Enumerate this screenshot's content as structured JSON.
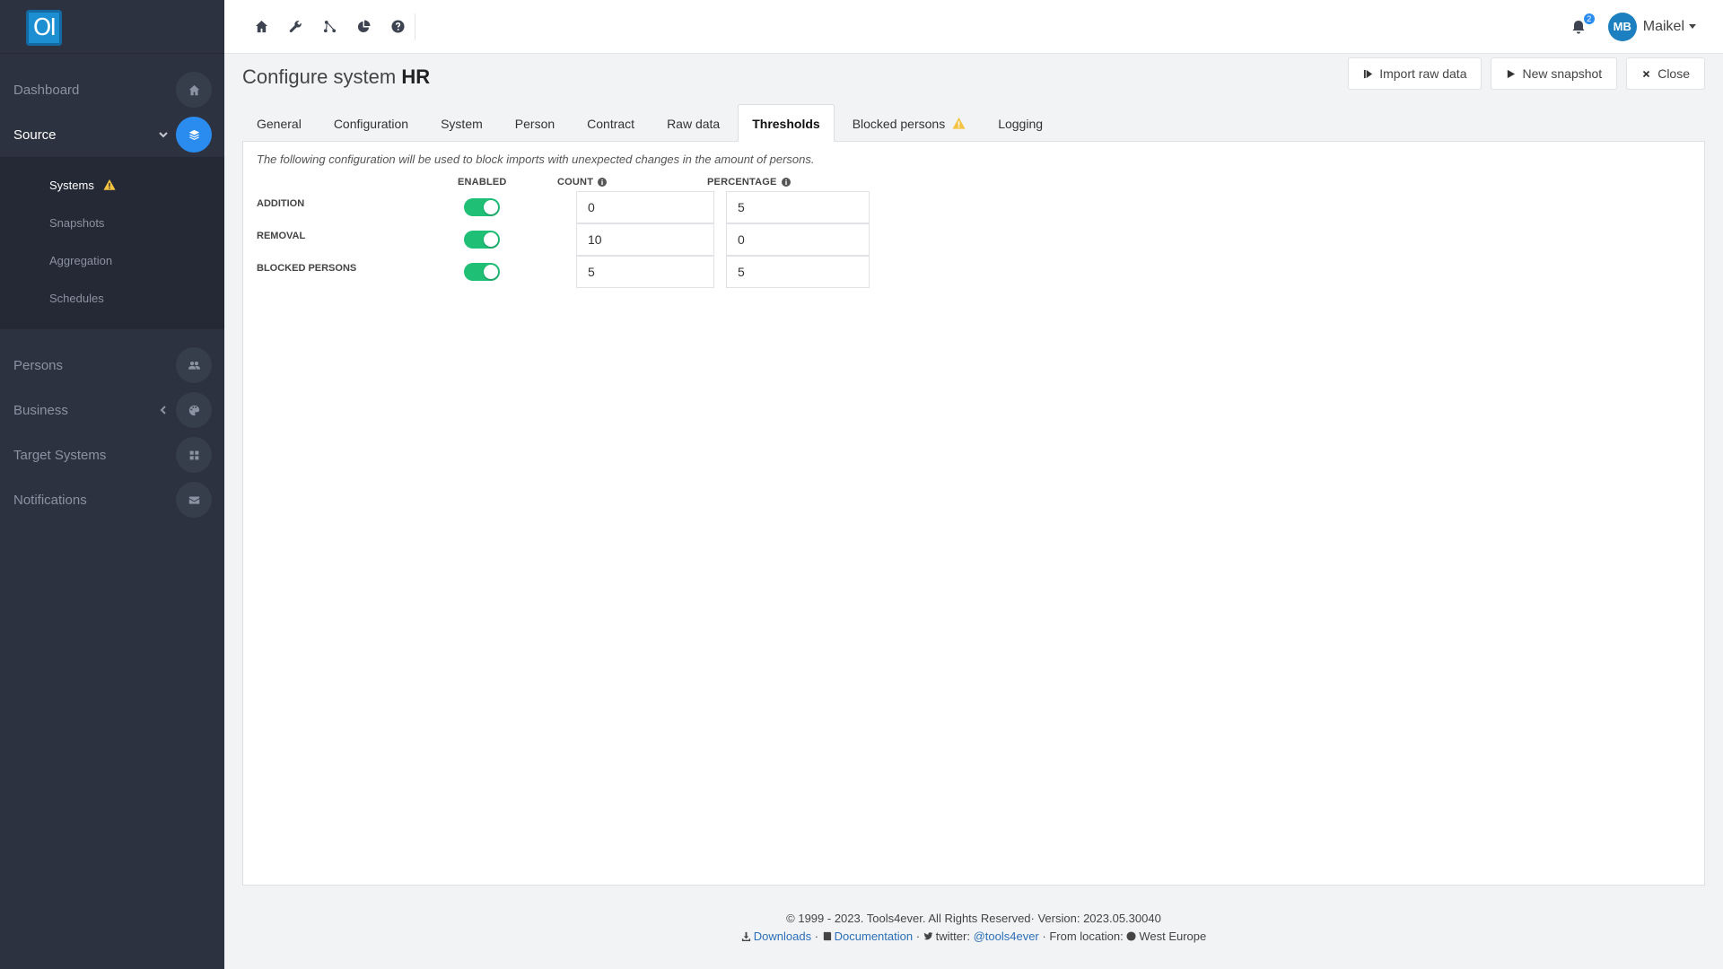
{
  "app": {
    "logo_text": "OI"
  },
  "sidebar": {
    "top_items": [
      {
        "label": "Dashboard",
        "icon": "home-icon"
      },
      {
        "label": "Source",
        "icon": "layers-icon",
        "active": true
      }
    ],
    "sub_items": [
      {
        "label": "Systems",
        "active": true,
        "warning": true
      },
      {
        "label": "Snapshots"
      },
      {
        "label": "Aggregation"
      },
      {
        "label": "Schedules"
      }
    ],
    "bottom_items": [
      {
        "label": "Persons",
        "icon": "users-icon"
      },
      {
        "label": "Business",
        "icon": "palette-icon"
      },
      {
        "label": "Target Systems",
        "icon": "grid-icon"
      },
      {
        "label": "Notifications",
        "icon": "envelope-icon"
      }
    ]
  },
  "topbar": {
    "icons": [
      "home-icon",
      "wrench-icon",
      "sitemap-icon",
      "pie-chart-icon",
      "help-icon"
    ],
    "notification_count": "2",
    "user_initials": "MB",
    "user_name": "Maikel"
  },
  "page": {
    "title_prefix": "Configure system",
    "title_system": "HR",
    "buttons": {
      "import_raw": "Import raw data",
      "new_snapshot": "New snapshot",
      "close": "Close"
    }
  },
  "tabs": [
    {
      "label": "General"
    },
    {
      "label": "Configuration"
    },
    {
      "label": "System"
    },
    {
      "label": "Person"
    },
    {
      "label": "Contract"
    },
    {
      "label": "Raw data"
    },
    {
      "label": "Thresholds",
      "active": true
    },
    {
      "label": "Blocked persons",
      "warning": true
    },
    {
      "label": "Logging"
    }
  ],
  "thresholds": {
    "description": "The following configuration will be used to block imports with unexpected changes in the amount of persons.",
    "headers": {
      "enabled": "ENABLED",
      "count": "COUNT",
      "percentage": "PERCENTAGE"
    },
    "rows": [
      {
        "label": "ADDITION",
        "enabled": true,
        "count": "0",
        "percentage": "5"
      },
      {
        "label": "REMOVAL",
        "enabled": true,
        "count": "10",
        "percentage": "0"
      },
      {
        "label": "BLOCKED PERSONS",
        "enabled": true,
        "count": "5",
        "percentage": "5"
      }
    ]
  },
  "footer": {
    "copyright": "© 1999 - 2023. Tools4ever. All Rights Reserved· Version: 2023.05.30040",
    "downloads": "Downloads",
    "documentation": "Documentation",
    "twitter_prefix": "twitter:",
    "twitter_handle": "@tools4ever",
    "location_prefix": "From location:",
    "location": "West Europe"
  },
  "colors": {
    "accent": "#2b8cf0",
    "toggle_on": "#1fbf76",
    "warning": "#f5c342",
    "sidebar_bg": "#2c323f"
  }
}
